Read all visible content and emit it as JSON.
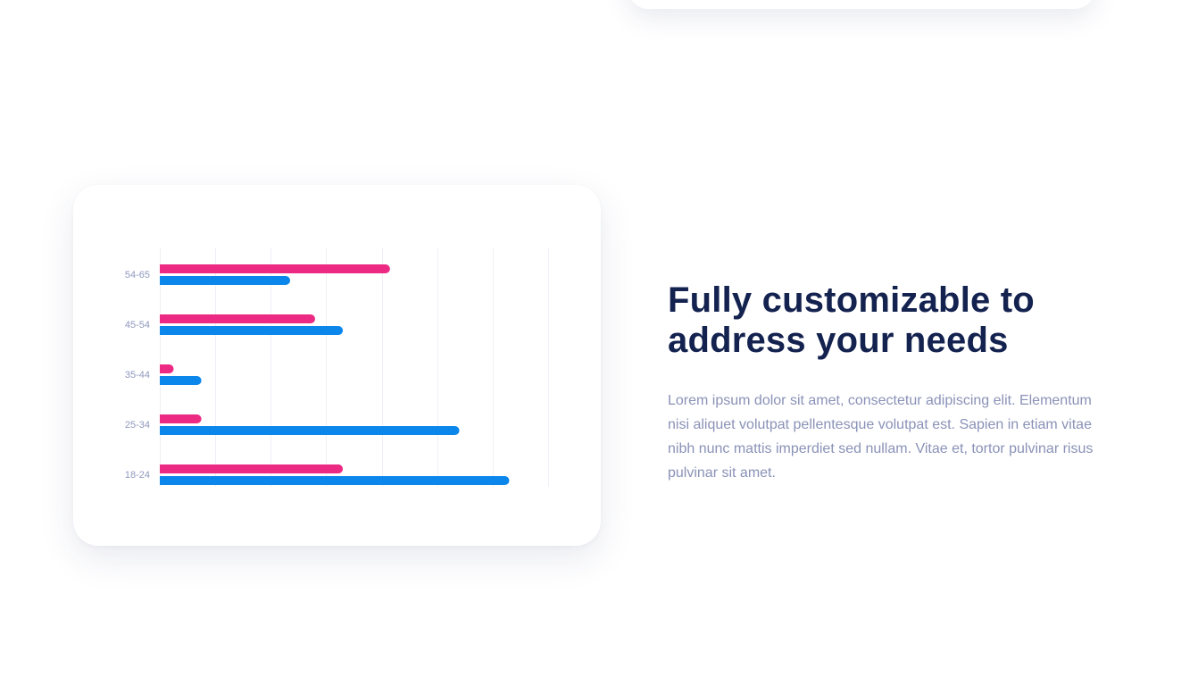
{
  "feature": {
    "headline_line1": "Fully customizable to",
    "headline_line2": "address your needs",
    "body": "Lorem ipsum dolor sit amet, consectetur adipiscing elit. Elementum nisi aliquet volutpat pellentesque volutpat est. Sapien in etiam vitae nibh nunc mattis imperdiet sed nullam. Vitae et, tortor pulvinar risus pulvinar sit amet."
  },
  "colors": {
    "series_a": "#ec2a84",
    "series_b": "#0b87ec",
    "heading": "#14224f",
    "body": "#8a92b7",
    "gridline": "#eef0f5"
  },
  "chart_data": {
    "type": "bar",
    "orientation": "horizontal",
    "categories": [
      "54-65",
      "45-54",
      "35-44",
      "25-34",
      "18-24"
    ],
    "series": [
      {
        "values": [
          4.15,
          2.8,
          0.25,
          0.75,
          3.3
        ]
      },
      {
        "values": [
          2.35,
          3.3,
          0.75,
          5.4,
          6.3
        ]
      }
    ],
    "xlim": [
      0,
      7
    ],
    "grid": true,
    "legend": "none",
    "xlabel": "",
    "ylabel": ""
  }
}
